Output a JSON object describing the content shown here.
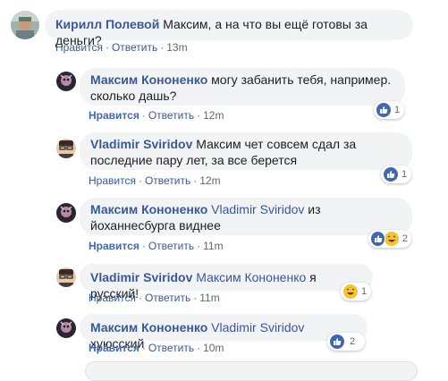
{
  "comments": [
    {
      "author": "Кирилл Полевой",
      "text": "Максим, а на что вы ещё готовы за деньги?",
      "like": "Нравится",
      "reply": "Ответить",
      "time": "13m"
    },
    {
      "author": "Максим Кононенко",
      "text": "могу забанить тебя, например. сколько дашь?",
      "like": "Нравится",
      "reply": "Ответить",
      "time": "12m",
      "reaction_count": "1"
    },
    {
      "author": "Vladimir Sviridov",
      "text": "Максим чет совсем сдал за последние пару лет, за все берется",
      "like": "Нравится",
      "reply": "Ответить",
      "time": "12m",
      "reaction_count": "1"
    },
    {
      "author": "Максим Кононенко",
      "mention": "Vladimir Sviridov",
      "text": "из йоханнесбурга виднее",
      "like": "Нравится",
      "reply": "Ответить",
      "time": "11m",
      "reaction_count": "2"
    },
    {
      "author": "Vladimir Sviridov",
      "mention": "Максим Кононенко",
      "text": "я русский!",
      "like": "Нравится",
      "reply": "Ответить",
      "time": "11m",
      "reaction_count": "1"
    },
    {
      "author": "Максим Кононенко",
      "mention": "Vladimir Sviridov",
      "text": "хуюсский",
      "like": "Нравится",
      "reply": "Ответить",
      "time": "10m",
      "reaction_count": "2"
    }
  ],
  "colors": {
    "link": "#385898",
    "bubble": "#f2f3f5",
    "like_blue": "#4267b2",
    "meta": "#606770"
  }
}
